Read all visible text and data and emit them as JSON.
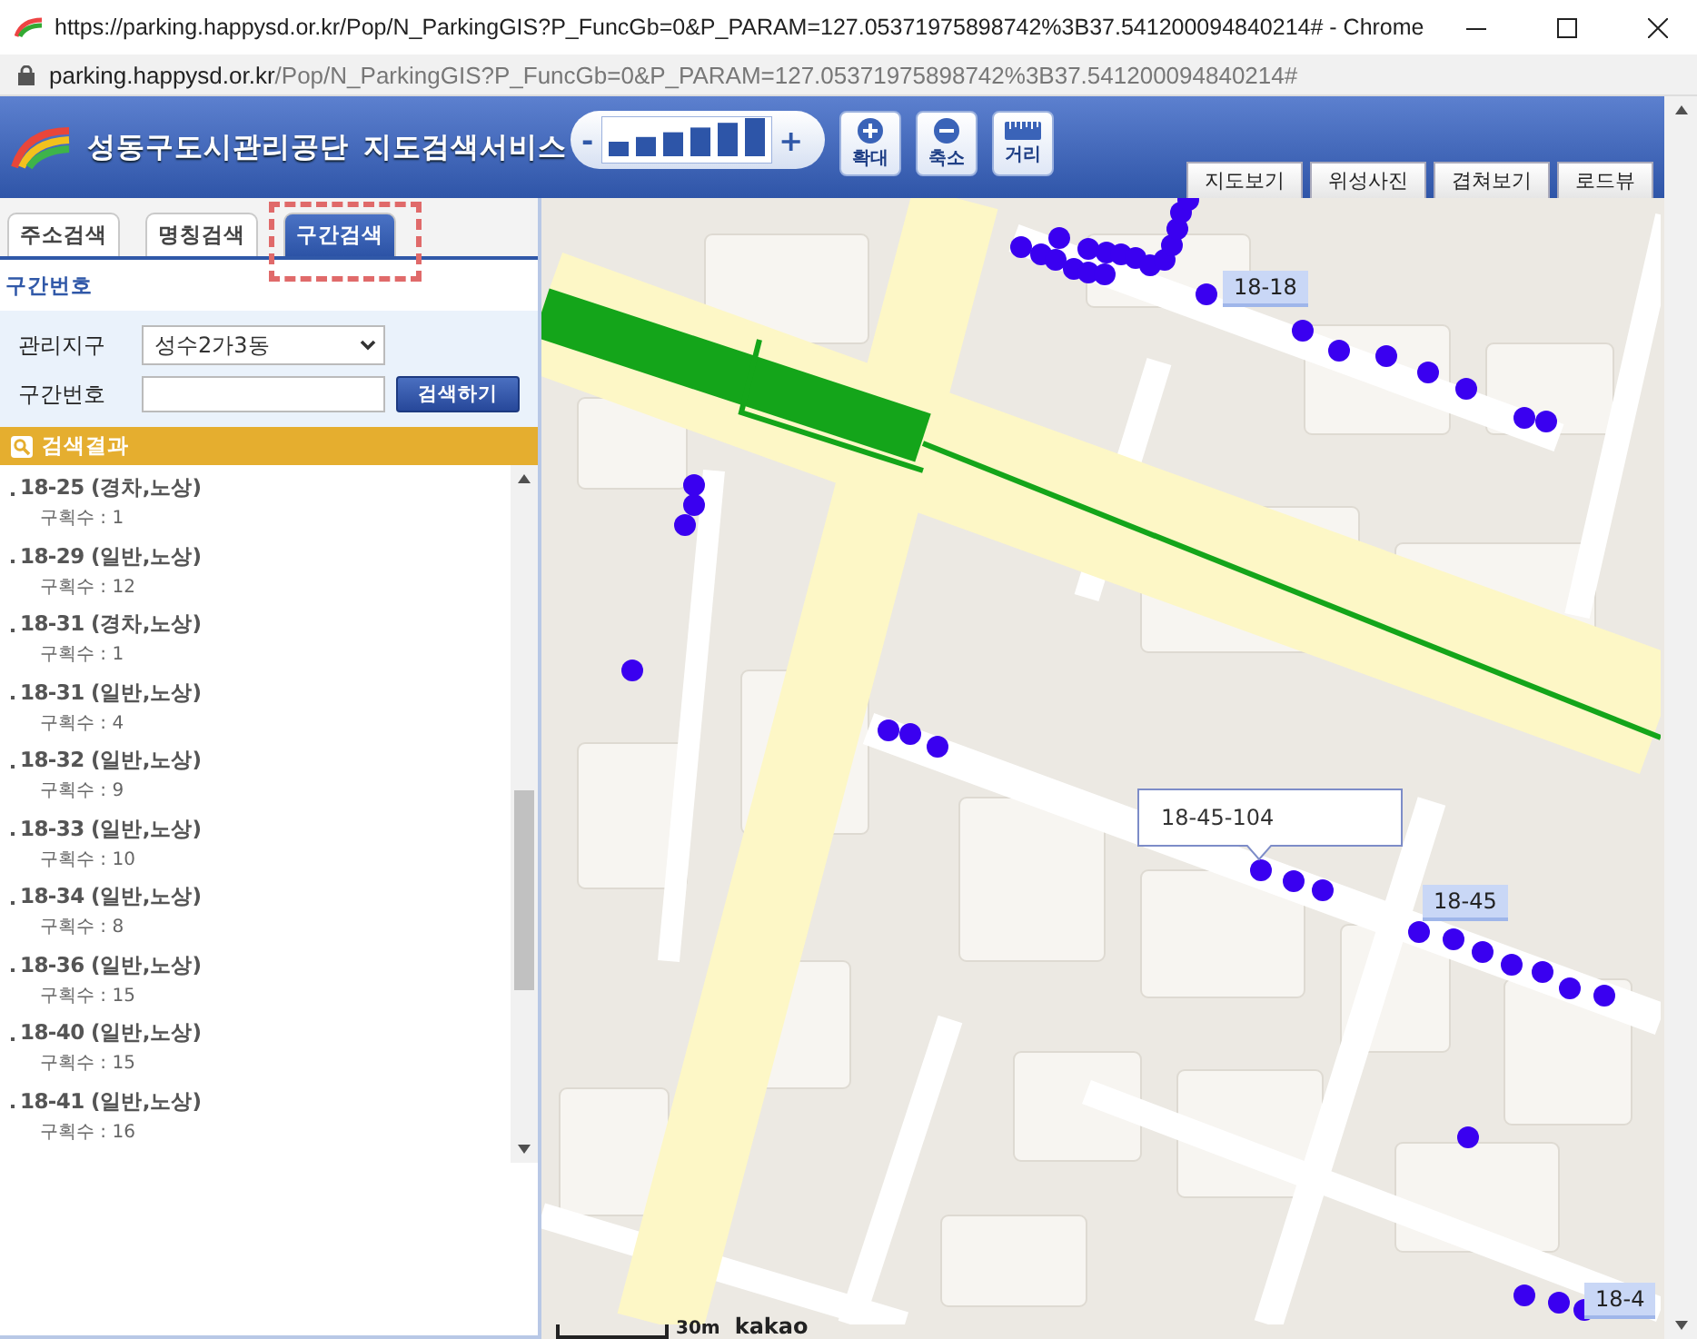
{
  "browser": {
    "title": "https://parking.happysd.or.kr/Pop/N_ParkingGIS?P_FuncGb=0&P_PARAM=127.05371975898742%3B37.541200094840214# - Chrome",
    "url_host": "parking.happysd.or.kr",
    "url_path": "/Pop/N_ParkingGIS?P_FuncGb=0&P_PARAM=127.05371975898742%3B37.541200094840214#"
  },
  "header": {
    "org": "성동구도시관리공단",
    "service": "지도검색서비스"
  },
  "zoom_control": {
    "minus": "-",
    "plus": "+"
  },
  "map_tools": [
    {
      "kind": "zoom_in",
      "label": "확대"
    },
    {
      "kind": "zoom_out",
      "label": "축소"
    },
    {
      "kind": "distance",
      "label": "거리"
    }
  ],
  "map_types": [
    "지도보기",
    "위성사진",
    "겹쳐보기",
    "로드뷰"
  ],
  "tabs": [
    {
      "label": "주소검색",
      "selected": false
    },
    {
      "label": "명칭검색",
      "selected": false
    },
    {
      "label": "구간검색",
      "selected": true
    }
  ],
  "section_title": "구간번호",
  "form": {
    "district_label": "관리지구",
    "district_value": "성수2가3동",
    "number_label": "구간번호",
    "button": "검색하기"
  },
  "results": {
    "title": "검색결과",
    "items": [
      {
        "name": "18-25 (경차,노상)",
        "count": "구획수 : 1"
      },
      {
        "name": "18-29 (일반,노상)",
        "count": "구획수 : 12"
      },
      {
        "name": "18-31 (경차,노상)",
        "count": "구획수 : 1"
      },
      {
        "name": "18-31 (일반,노상)",
        "count": "구획수 : 4"
      },
      {
        "name": "18-32 (일반,노상)",
        "count": "구획수 : 9"
      },
      {
        "name": "18-33 (일반,노상)",
        "count": "구획수 : 10"
      },
      {
        "name": "18-34 (일반,노상)",
        "count": "구획수 : 8"
      },
      {
        "name": "18-36 (일반,노상)",
        "count": "구획수 : 15"
      },
      {
        "name": "18-40 (일반,노상)",
        "count": "구획수 : 15"
      },
      {
        "name": "18-41 (일반,노상)",
        "count": "구획수 : 16"
      }
    ]
  },
  "map": {
    "sections": [
      {
        "label": "18-18"
      },
      {
        "label": "18-45"
      },
      {
        "label": "18-4"
      }
    ],
    "popup": "18-45-104",
    "scale": "30m",
    "attribution": "kakao"
  }
}
